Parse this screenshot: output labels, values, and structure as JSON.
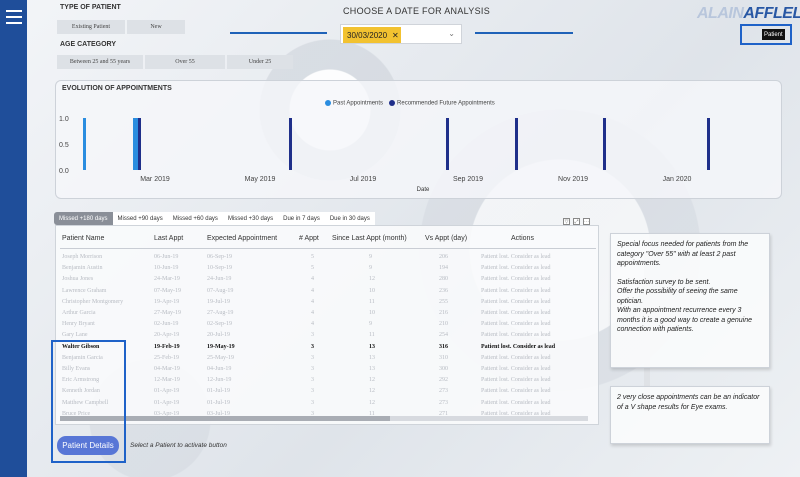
{
  "filters": {
    "type_title": "TYPE OF PATIENT",
    "type_options": [
      "Existing Patient",
      "New"
    ],
    "age_title": "AGE CATEGORY",
    "age_options": [
      "Between 25 and 55 years",
      "Over 55",
      "Under 25"
    ]
  },
  "date": {
    "title": "CHOOSE A DATE FOR ANALYSIS",
    "value": "30/03/2020",
    "clear": "✕",
    "chevron": "⌄"
  },
  "logo": {
    "light": "ALAIN",
    "bold": "AFFLELOU"
  },
  "patient_button": "Patient",
  "chart_data": {
    "type": "bar",
    "title": "EVOLUTION OF APPOINTMENTS",
    "xlabel": "Date",
    "ylabel": "",
    "ylim": [
      0,
      1
    ],
    "y_ticks": [
      "1.0",
      "0.5",
      "0.0"
    ],
    "x_ticks": [
      "Mar 2019",
      "May 2019",
      "Jul 2019",
      "Sep 2019",
      "Nov 2019",
      "Jan 2020"
    ],
    "series": [
      {
        "name": "Past Appointments",
        "color": "#2a8de0",
        "values": [
          1,
          1,
          1
        ]
      },
      {
        "name": "Recommended Future Appointments",
        "color": "#1f2f8a",
        "values": [
          1,
          1,
          1,
          1,
          1,
          1,
          1,
          1
        ]
      }
    ],
    "legend_position": "top"
  },
  "tabs": [
    "Missed +180 days",
    "Missed +90 days",
    "Missed +60 days",
    "Missed +30 days",
    "Due in 7 days",
    "Due in 30 days"
  ],
  "table": {
    "columns": [
      "Patient Name",
      "Last Appt",
      "Expected Appointment",
      "# Appt",
      "Since Last Appt (month)",
      "Vs Appt (day)",
      "Actions"
    ],
    "rows": [
      [
        "Joseph Morrison",
        "06-Jun-19",
        "06-Sep-19",
        "5",
        "9",
        "206",
        "Patient lost. Consider as lead"
      ],
      [
        "Benjamin Austin",
        "10-Jun-19",
        "10-Sep-19",
        "5",
        "9",
        "194",
        "Patient lost. Consider as lead"
      ],
      [
        "Joshua Jones",
        "24-Mar-19",
        "24-Jun-19",
        "4",
        "12",
        "280",
        "Patient lost. Consider as lead"
      ],
      [
        "Lawrence Graham",
        "07-May-19",
        "07-Aug-19",
        "4",
        "10",
        "236",
        "Patient lost. Consider as lead"
      ],
      [
        "Christopher Montgomery",
        "19-Apr-19",
        "19-Jul-19",
        "4",
        "11",
        "255",
        "Patient lost. Consider as lead"
      ],
      [
        "Arthur Garcia",
        "27-May-19",
        "27-Aug-19",
        "4",
        "10",
        "216",
        "Patient lost. Consider as lead"
      ],
      [
        "Henry Bryant",
        "02-Jun-19",
        "02-Sep-19",
        "4",
        "9",
        "210",
        "Patient lost. Consider as lead"
      ],
      [
        "Gary Lane",
        "20-Apr-19",
        "20-Jul-19",
        "3",
        "11",
        "254",
        "Patient lost. Consider as lead"
      ],
      [
        "Walter Gibson",
        "19-Feb-19",
        "19-May-19",
        "3",
        "13",
        "316",
        "Patient lost. Consider as lead"
      ],
      [
        "Benjamin Garcia",
        "25-Feb-19",
        "25-May-19",
        "3",
        "13",
        "310",
        "Patient lost. Consider as lead"
      ],
      [
        "Billy Evans",
        "04-Mar-19",
        "04-Jun-19",
        "3",
        "13",
        "300",
        "Patient lost. Consider as lead"
      ],
      [
        "Eric Armstrong",
        "12-Mar-19",
        "12-Jun-19",
        "3",
        "12",
        "292",
        "Patient lost. Consider as lead"
      ],
      [
        "Kenneth Jordan",
        "01-Apr-19",
        "01-Jul-19",
        "3",
        "12",
        "273",
        "Patient lost. Consider as lead"
      ],
      [
        "Matthew Campbell",
        "01-Apr-19",
        "01-Jul-19",
        "3",
        "12",
        "273",
        "Patient lost. Consider as lead"
      ],
      [
        "Bruce Price",
        "03-Apr-19",
        "03-Jul-19",
        "3",
        "11",
        "271",
        "Patient lost. Consider as lead"
      ]
    ],
    "selected_index": 8
  },
  "patient_details": {
    "button": "Patient Details",
    "hint": "Select a Patient to activate button"
  },
  "notes": {
    "focus": [
      "Special focus needed for patients from the category \"Over 55\" with at least 2 past appointments.",
      "Satisfaction survey to be sent.\nOffer the possibility of seeing the same optician.\nWith an appointment recurrence every 3 months it is a good way to create a genuine connection with patients."
    ],
    "vshape": "2 very close appointments can be an indicator of a V shape results for Eye exams."
  }
}
